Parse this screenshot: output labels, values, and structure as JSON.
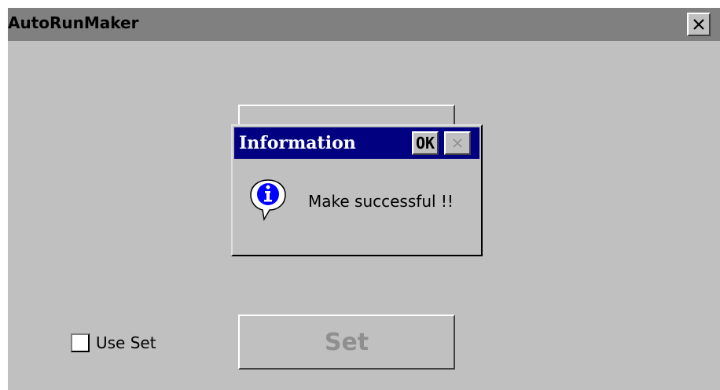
{
  "window": {
    "title": "AutoRunMaker",
    "close_icon": "close-icon"
  },
  "options": {
    "use_set_label": "Use Set",
    "use_set_checked": false
  },
  "buttons": {
    "set_label": "Set",
    "set_enabled": false
  },
  "dialog": {
    "title": "Information",
    "ok_label": "OK",
    "close_icon": "close-icon",
    "close_enabled": false,
    "icon": "info-icon",
    "message": "Make successful !!"
  },
  "colors": {
    "window_bg": "#c0c0c0",
    "titlebar": "#808080",
    "dialog_titlebar": "#000080",
    "disabled_text": "#8f8f8f"
  }
}
